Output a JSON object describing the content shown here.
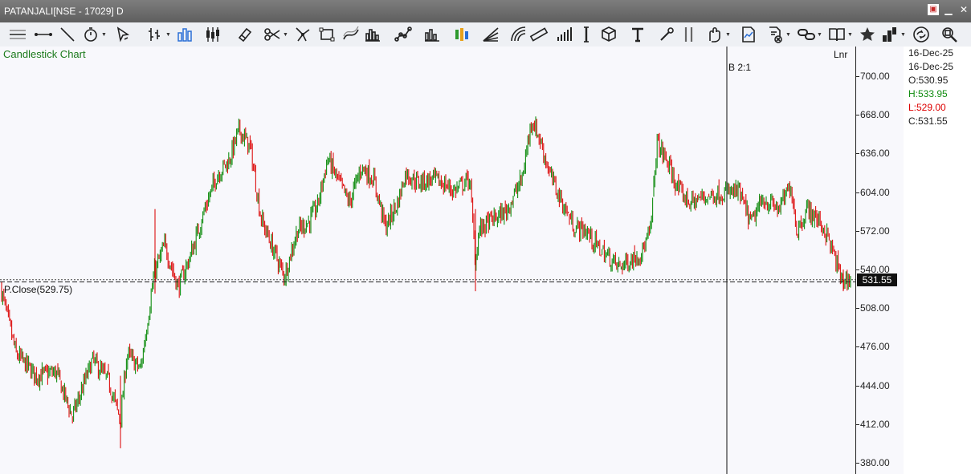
{
  "window": {
    "title": "PATANJALI[NSE - 17029] D"
  },
  "window_controls": [
    "restore",
    "minimize",
    "close"
  ],
  "toolbar": {
    "tools": [
      "horizontal-line-icon",
      "horizontal-segment-icon",
      "trend-line-icon",
      "stopwatch-icon",
      "cursor-icon",
      "bar-style-icon",
      "volume-bars-icon",
      "candlestick-icon",
      "eraser-icon",
      "scissors-icon",
      "fork-icon",
      "rectangle-icon",
      "curve-icon",
      "histogram-icon",
      "scatter-icon",
      "column-chart-icon",
      "colored-bars-icon",
      "fan-lines-icon",
      "arc-icon",
      "ruler-icon",
      "signal-bars-icon",
      "vertical-line-icon",
      "cube-icon",
      "text-tool-icon",
      "tools-icon",
      "double-line-icon",
      "hand-icon",
      "chart-doc-icon",
      "page-close-icon",
      "link-icon",
      "book-icon",
      "star-icon",
      "bar-layout-icon",
      "refresh-arrows-icon",
      "zoom-fit-icon"
    ]
  },
  "chart": {
    "title": "Candlestick Chart",
    "scale_mode": "Lnr",
    "split_label": "B 2:1",
    "prev_close_label": "P.Close(529.75)",
    "last_price_label": "531.55",
    "y_ticks": [
      "700.00",
      "668.00",
      "636.00",
      "604.00",
      "572.00",
      "540.00",
      "508.00",
      "476.00",
      "444.00",
      "412.00",
      "380.00"
    ],
    "colors": {
      "up": "#118d11",
      "down": "#dd1111",
      "background": "#f8f8fc"
    }
  },
  "info": {
    "date1": "16-Dec-25",
    "date2": "16-Dec-25",
    "open": "O:530.95",
    "high": "H:533.95",
    "low": "L:529.00",
    "close": "C:531.55"
  },
  "chart_data": {
    "type": "candlestick",
    "ylim": [
      380,
      700
    ],
    "prev_close": 529.75,
    "last_close": 531.55,
    "last_candle": {
      "date": "16-Dec-25",
      "open": 530.95,
      "high": 533.95,
      "low": 529.0,
      "close": 531.55
    },
    "split_event": "B 2:1",
    "close_path": [
      [
        0,
        527
      ],
      [
        20,
        470
      ],
      [
        45,
        452
      ],
      [
        70,
        455
      ],
      [
        90,
        418
      ],
      [
        115,
        465
      ],
      [
        135,
        448
      ],
      [
        150,
        415
      ],
      [
        158,
        470
      ],
      [
        175,
        457
      ],
      [
        192,
        537
      ],
      [
        205,
        560
      ],
      [
        222,
        525
      ],
      [
        238,
        553
      ],
      [
        255,
        590
      ],
      [
        270,
        618
      ],
      [
        285,
        630
      ],
      [
        298,
        656
      ],
      [
        312,
        640
      ],
      [
        325,
        582
      ],
      [
        340,
        557
      ],
      [
        354,
        534
      ],
      [
        370,
        572
      ],
      [
        385,
        580
      ],
      [
        395,
        592
      ],
      [
        408,
        632
      ],
      [
        420,
        615
      ],
      [
        435,
        595
      ],
      [
        450,
        625
      ],
      [
        465,
        615
      ],
      [
        480,
        575
      ],
      [
        495,
        595
      ],
      [
        505,
        620
      ],
      [
        520,
        612
      ],
      [
        540,
        615
      ],
      [
        555,
        610
      ],
      [
        565,
        605
      ],
      [
        585,
        615
      ],
      [
        592,
        545
      ],
      [
        596,
        572
      ],
      [
        610,
        580
      ],
      [
        630,
        588
      ],
      [
        650,
        615
      ],
      [
        662,
        665
      ],
      [
        672,
        648
      ],
      [
        685,
        618
      ],
      [
        700,
        595
      ],
      [
        715,
        575
      ],
      [
        730,
        572
      ],
      [
        742,
        560
      ],
      [
        755,
        552
      ],
      [
        770,
        542
      ],
      [
        785,
        548
      ],
      [
        800,
        555
      ],
      [
        810,
        572
      ],
      [
        818,
        645
      ],
      [
        830,
        630
      ],
      [
        845,
        605
      ],
      [
        860,
        595
      ],
      [
        875,
        600
      ],
      [
        890,
        602
      ],
      [
        905,
        604
      ],
      [
        920,
        604
      ],
      [
        935,
        578
      ],
      [
        950,
        598
      ],
      [
        970,
        590
      ],
      [
        985,
        610
      ],
      [
        992,
        572
      ],
      [
        1005,
        590
      ],
      [
        1020,
        580
      ],
      [
        1030,
        568
      ],
      [
        1040,
        548
      ],
      [
        1048,
        531
      ],
      [
        1058,
        531.5
      ]
    ]
  }
}
